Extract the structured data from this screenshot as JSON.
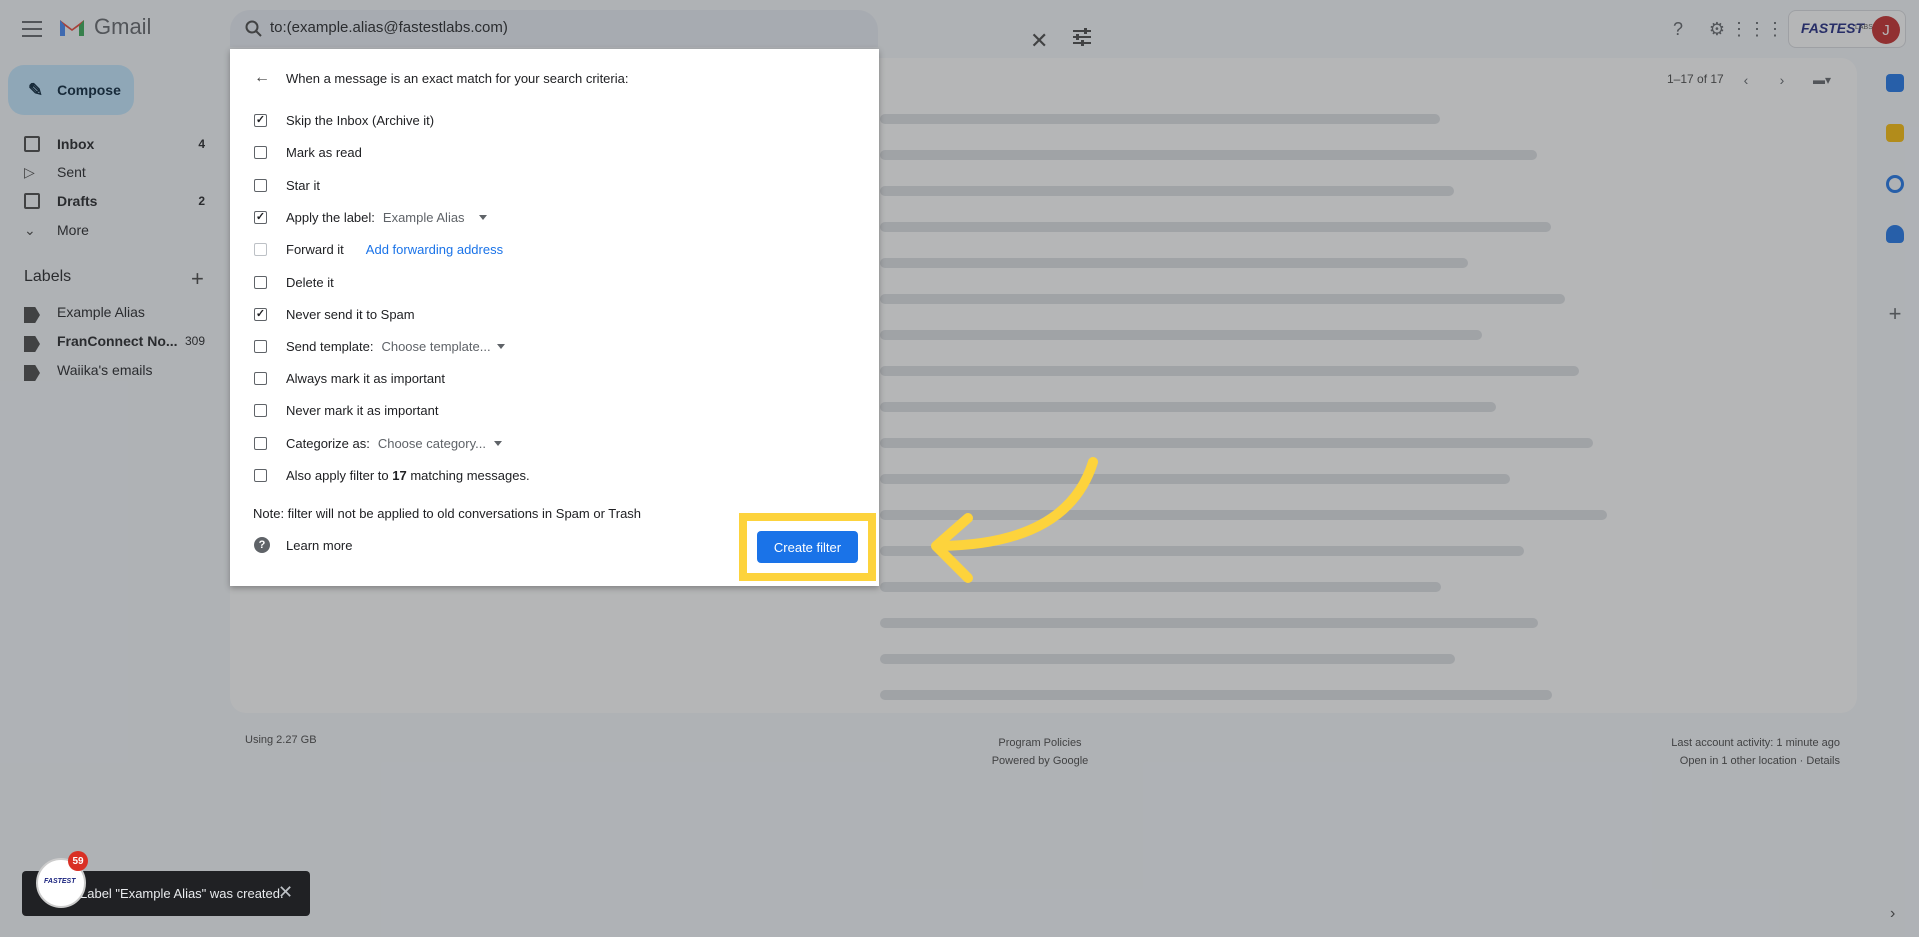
{
  "header": {
    "app_name": "Gmail",
    "search_value": "to:(example.alias@fastestlabs.com)",
    "brand": "FASTEST",
    "brand_suffix": "LABS",
    "avatar_initial": "J"
  },
  "sidebar": {
    "compose_label": "Compose",
    "items": [
      {
        "label": "Inbox",
        "count": "4",
        "icon": "inbox-icon"
      },
      {
        "label": "Sent",
        "count": "",
        "icon": "send-icon"
      },
      {
        "label": "Drafts",
        "count": "2",
        "icon": "draft-icon"
      },
      {
        "label": "More",
        "count": "",
        "icon": "chevron-down-icon"
      }
    ],
    "labels_title": "Labels",
    "labels": [
      {
        "label": "Example Alias",
        "count": ""
      },
      {
        "label": "FranConnect No...",
        "count": "309"
      },
      {
        "label": "Waiika's emails",
        "count": ""
      }
    ]
  },
  "main": {
    "pager": "1–17 of 17"
  },
  "filter_dialog": {
    "heading": "When a message is an exact match for your search criteria:",
    "options": {
      "skip_inbox": "Skip the Inbox (Archive it)",
      "mark_read": "Mark as read",
      "star": "Star it",
      "apply_label": "Apply the label:",
      "apply_label_value": "Example Alias",
      "forward": "Forward it",
      "forward_link": "Add forwarding address",
      "delete": "Delete it",
      "never_spam": "Never send it to Spam",
      "send_template": "Send template:",
      "send_template_value": "Choose template...",
      "always_important": "Always mark it as important",
      "never_important": "Never mark it as important",
      "categorize": "Categorize as:",
      "categorize_value": "Choose category...",
      "also_apply_prefix": "Also apply filter to",
      "also_apply_count": "17",
      "also_apply_suffix": "matching messages."
    },
    "note": "Note: filter will not be applied to old conversations in Spam or Trash",
    "learn_more": "Learn more",
    "create_button": "Create filter"
  },
  "footer": {
    "storage": "Using 2.27 GB",
    "policies": "Program Policies",
    "powered": "Powered by Google",
    "activity": "Last account activity: 1 minute ago",
    "open_in": "Open in 1 other location · Details"
  },
  "toast": {
    "text": "Label \"Example Alias\" was created.",
    "badge": "59"
  },
  "colors": {
    "highlight": "#fdd33c",
    "primary": "#1a73e8"
  }
}
